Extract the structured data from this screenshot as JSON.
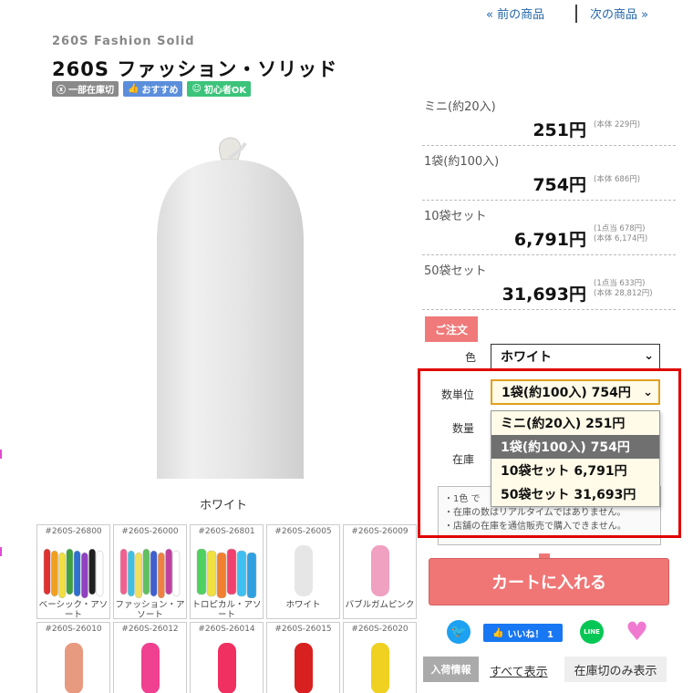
{
  "nav": {
    "prev": "« 前の商品",
    "next": "次の商品 »"
  },
  "product": {
    "subtitle": "260S Fashion Solid",
    "title": "260S ファッション・ソリッド",
    "badges": [
      {
        "label": "一部在庫切",
        "icon": "circle-x-icon",
        "color": "#8a8a8a"
      },
      {
        "label": "おすすめ",
        "icon": "thumbs-up-icon",
        "color": "#5b8fdc"
      },
      {
        "label": "初心者OK",
        "icon": "smile-icon",
        "color": "#3cc47a"
      }
    ],
    "image_caption": "ホワイト"
  },
  "prices": [
    {
      "label": "ミニ(約20入)",
      "price": "251円",
      "note1": "(本体 229円)",
      "note2": ""
    },
    {
      "label": "1袋(約100入)",
      "price": "754円",
      "note1": "(本体 686円)",
      "note2": ""
    },
    {
      "label": "10袋セット",
      "price": "6,791円",
      "note1": "(1点当 678円)",
      "note2": "(本体 6,174円)"
    },
    {
      "label": "50袋セット",
      "price": "31,693円",
      "note1": "(1点当 633円)",
      "note2": "(本体 28,812円)"
    }
  ],
  "order": {
    "tag": "ご注文",
    "color_label": "色",
    "color_value": "ホワイト",
    "unit_label": "数単位",
    "unit_value": "1袋(約100入) 754円",
    "qty_label": "数量",
    "stock_label": "在庫",
    "unit_options": [
      "ミニ(約20入) 251円",
      "1袋(約100入) 754円",
      "10袋セット 6,791円",
      "50袋セット 31,693円"
    ],
    "selected_option": 1,
    "notice": [
      "・1色 で",
      "・在庫の数はリアルタイムではありません。",
      "・店舗の在庫を通信販売で購入できません。"
    ]
  },
  "cart_button": "カートに入れる",
  "social": {
    "twitter": "twitter-icon",
    "facebook": "いいね！ 1",
    "line": "LINE"
  },
  "stock_tabs": {
    "label": "入荷情報",
    "all": "すべて表示",
    "out": "在庫切のみ表示"
  },
  "thumbnails": [
    {
      "code": "#260S-26800",
      "name": "ベーシック・アソート",
      "kind": "multi",
      "colors": [
        "#e03030",
        "#f0a020",
        "#f0e040",
        "#40a040",
        "#3070d0",
        "#9040c0",
        "#202020",
        "#ffffff"
      ]
    },
    {
      "code": "#260S-26000",
      "name": "ファッション・アソート",
      "kind": "multi",
      "colors": [
        "#f06090",
        "#40c0e0",
        "#f0e060",
        "#60c060",
        "#4060d0",
        "#f08040",
        "#c040a0",
        "#ffffff"
      ]
    },
    {
      "code": "#260S-26801",
      "name": "トロピカル・アソート",
      "kind": "multi",
      "colors": [
        "#50d060",
        "#f0e040",
        "#f08030",
        "#f04070",
        "#40c0f0",
        "#30a0e0"
      ]
    },
    {
      "code": "#260S-26005",
      "name": "ホワイト",
      "kind": "single",
      "colors": [
        "#e6e6e6"
      ]
    },
    {
      "code": "#260S-26009",
      "name": "バブルガムピンク",
      "kind": "single",
      "colors": [
        "#f0a0c0"
      ]
    },
    {
      "code": "#260S-26010",
      "name": "",
      "kind": "single",
      "colors": [
        "#e89a80"
      ]
    },
    {
      "code": "#260S-26012",
      "name": "",
      "kind": "single",
      "colors": [
        "#f04090"
      ]
    },
    {
      "code": "#260S-26014",
      "name": "",
      "kind": "single",
      "colors": [
        "#f03060"
      ]
    },
    {
      "code": "#260S-26015",
      "name": "",
      "kind": "single",
      "colors": [
        "#d82020"
      ]
    },
    {
      "code": "#260S-26020",
      "name": "",
      "kind": "single",
      "colors": [
        "#f0d020"
      ]
    }
  ],
  "colors": {
    "accent": "#f07676",
    "highlight": "#e00000",
    "link": "#2266aa"
  }
}
